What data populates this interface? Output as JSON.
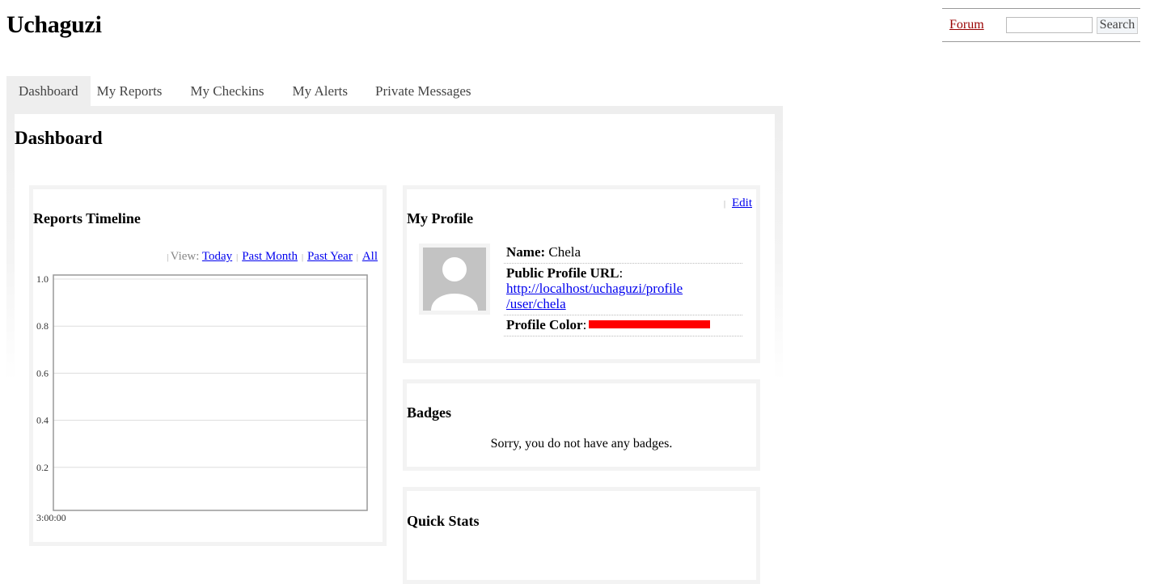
{
  "site": {
    "title": "Uchaguzi"
  },
  "topbar": {
    "forum_label": "Forum",
    "search_value": "",
    "search_placeholder": "",
    "search_button": "Search"
  },
  "tabs": [
    {
      "label": "Dashboard",
      "active": true
    },
    {
      "label": "My Reports",
      "active": false
    },
    {
      "label": "My Checkins",
      "active": false
    },
    {
      "label": "My Alerts",
      "active": false
    },
    {
      "label": "Private Messages",
      "active": false
    }
  ],
  "page": {
    "title": "Dashboard"
  },
  "timeline": {
    "title": "Reports Timeline",
    "view_label": "View:",
    "view_links": [
      "Today",
      "Past Month",
      "Past Year",
      "All"
    ]
  },
  "chart_data": {
    "type": "line",
    "title": "",
    "xlabel": "",
    "ylabel": "",
    "x_ticks": [
      "3:00:00"
    ],
    "y_ticks": [
      "0.2",
      "0.4",
      "0.6",
      "0.8",
      "1.0"
    ],
    "ylim": [
      0,
      1.0
    ],
    "grid": true,
    "series": []
  },
  "profile": {
    "title": "My Profile",
    "edit_label": "Edit",
    "avatar_icon": "default-user-avatar-icon",
    "name_label": "Name:",
    "name_value": "Chela",
    "url_label": "Public Profile URL",
    "url_value_line1": "http://localhost/uchaguzi/profile",
    "url_value_line2": "/user/chela",
    "color_label": "Profile Color",
    "color_value": "#ff0000"
  },
  "badges": {
    "title": "Badges",
    "empty_message": "Sorry, you do not have any badges."
  },
  "stats": {
    "title": "Quick Stats"
  }
}
